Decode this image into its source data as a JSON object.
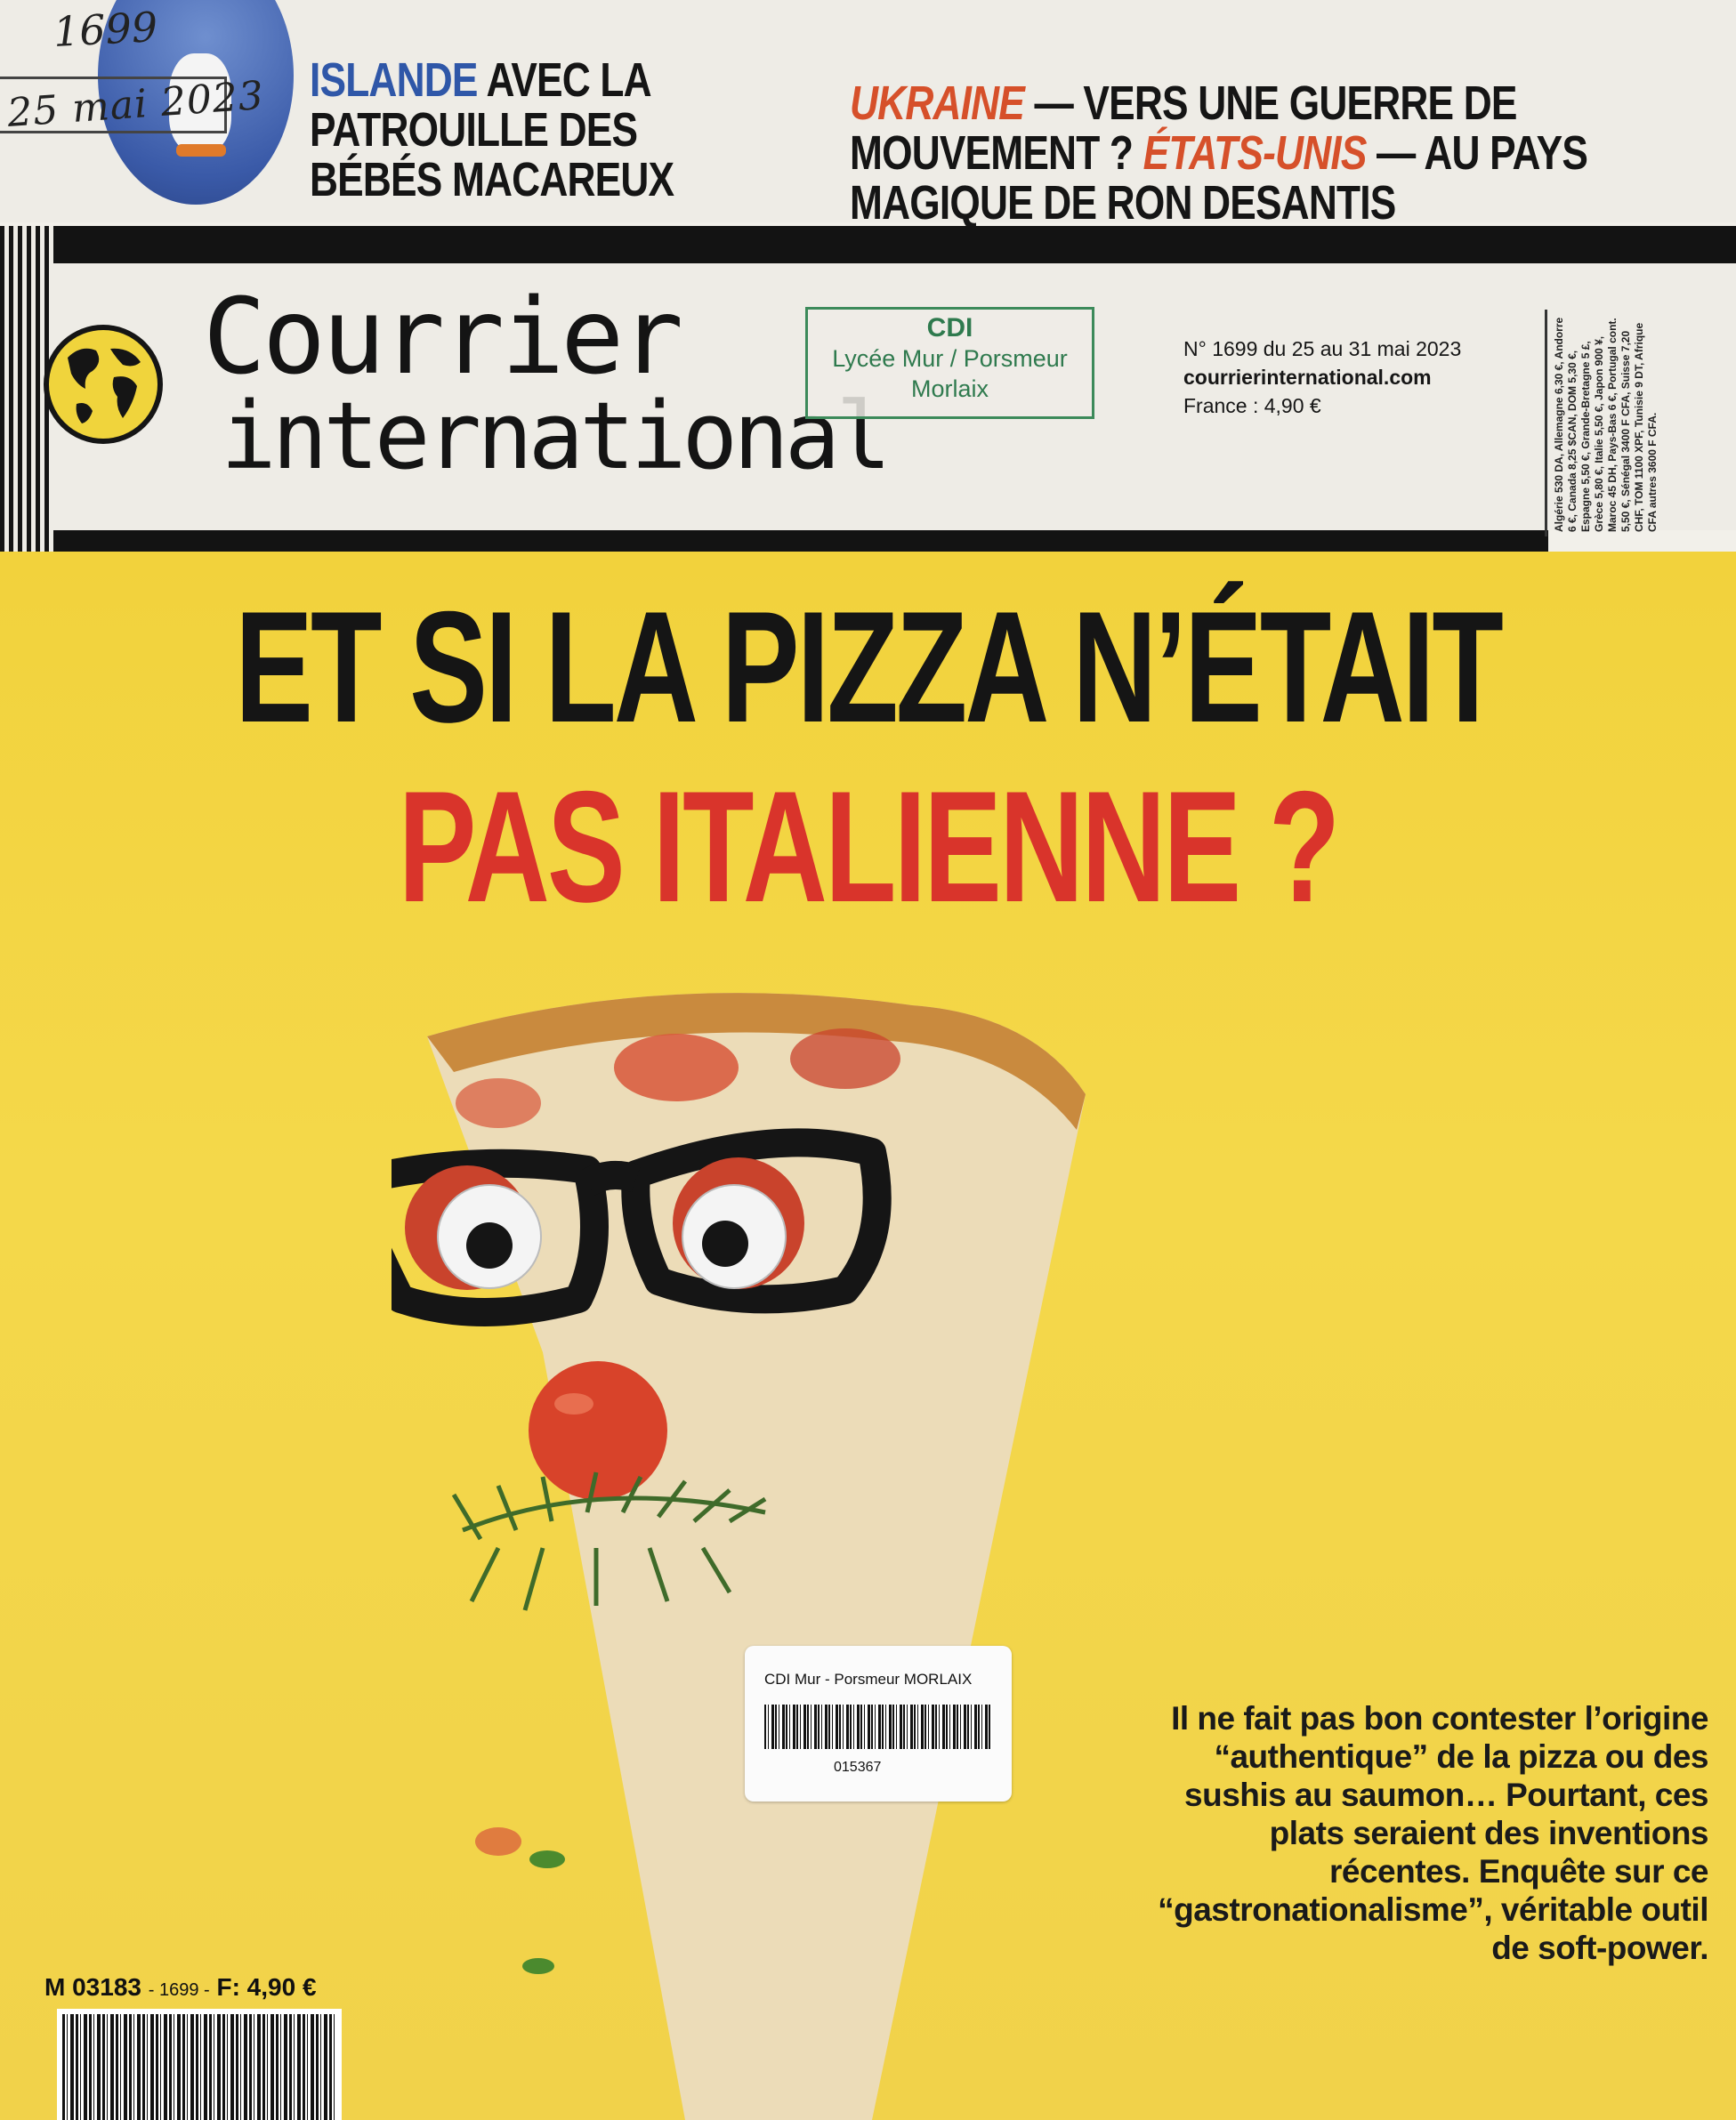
{
  "annotations": {
    "issue_handwritten": "1699",
    "date_handwritten": "25 mai 2023"
  },
  "teasers": {
    "left": {
      "keyword": "ISLANDE",
      "text": " AVEC LA PATROUILLE DES BÉBÉS MACAREUX"
    },
    "right": {
      "kw1": "UKRAINE",
      "t1": " — VERS UNE GUERRE DE MOUVEMENT ? ",
      "kw2": "ÉTATS-UNIS",
      "t2": " — AU PAYS MAGIQUE DE RON DESANTIS"
    }
  },
  "masthead": {
    "logo_line1": "Courrier",
    "logo_line2": "international",
    "stamp": {
      "line1": "CDI",
      "line2": "Lycée Mur / Porsmeur",
      "line3": "Morlaix"
    },
    "issue": "N° 1699 du 25 au 31 mai 2023",
    "website": "courrierinternational.com",
    "price_france": "France : 4,90 €",
    "intl_prices": "Algérie 530 DA, Allemagne 6,30 €, Andorre 6 €, Canada 8,25 $CAN, DOM 5,30 €, Espagne 5,50 €, Grande-Bretagne 5 £, Grèce 5,80 €, Italie 5,50 €, Japon 900 ¥, Maroc 45 DH, Pays-Bas 6 €, Portugal cont. 5,50 €, Sénégal 3400 F CFA, Suisse 7,20 CHF, TOM 1100 XPF, Tunisie 9 DT, Afrique CFA autres 3600 F CFA."
  },
  "cover": {
    "headline_line1": "ET SI LA PIZZA N’ÉTAIT",
    "headline_line2": "PAS ITALIENNE ?",
    "subtext": "Il ne fait pas bon contester l’origine “authentique” de la pizza ou des sushis au saumon… Pourtant, ces plats seraient des inventions récentes. Enquête sur ce “gastronationalisme”, véritable outil de soft-power.",
    "colors": {
      "yellow": "#f2d23c",
      "red": "#d9342b",
      "blue": "#2f57a8",
      "orange": "#d6502a"
    }
  },
  "library_sticker": {
    "title": "CDI Mur - Porsmeur MORLAIX",
    "number": "015367"
  },
  "price_code": {
    "code": "M 03183",
    "issue": "- 1699 -",
    "price": "F: 4,90 €"
  },
  "icons": [
    "globe-icon",
    "puffin-photo",
    "barcode-icon"
  ]
}
